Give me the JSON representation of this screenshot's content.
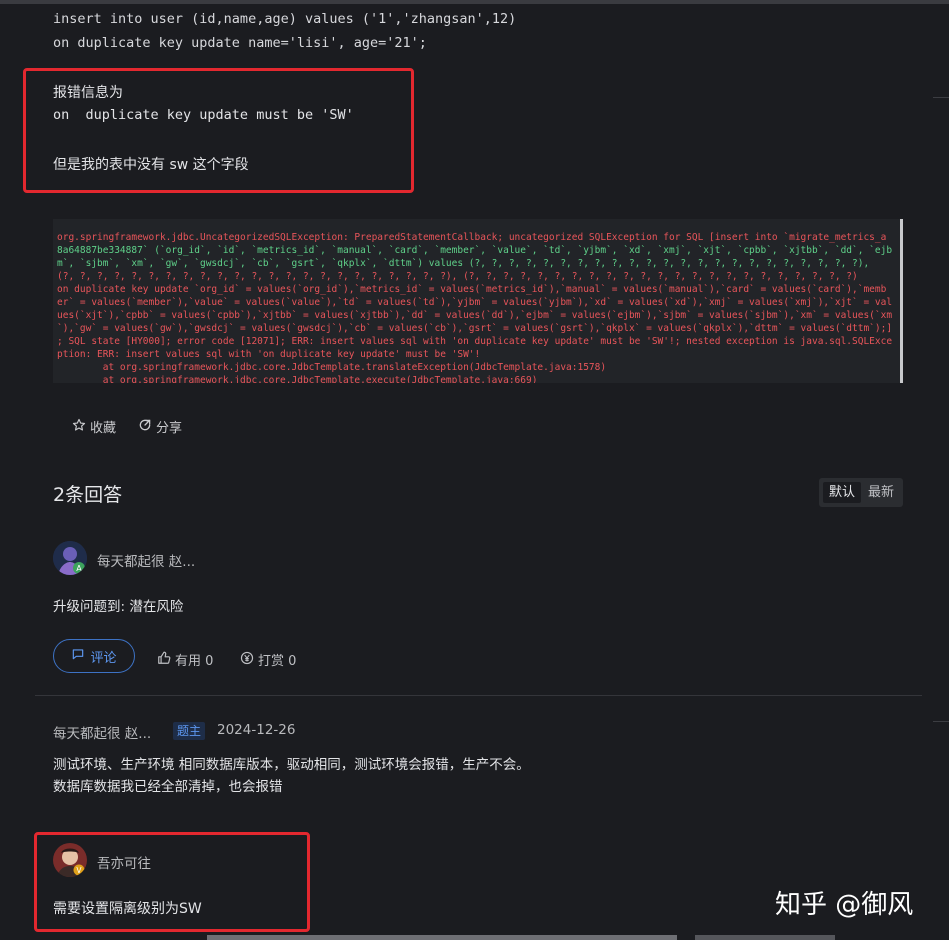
{
  "question": {
    "sql_lines": [
      "insert into user (id,name,age) values ('1','zhangsan',12)",
      "on duplicate key update name='lisi', age='21';"
    ],
    "error_note_lines": [
      "报错信息为",
      "on  duplicate key update must be 'SW'",
      "但是我的表中没有 sw 这个字段"
    ],
    "log_lines": [
      {
        "text": "org.springframework.jdbc.UncategorizedSQLException: PreparedStatementCallback; uncategorized SQLException for SQL [insert into `migrate_metrics_a",
        "c": "r"
      },
      {
        "text": "8a64887be334887` (`org_id`, `id`, `metrics_id`, `manual`, `card`, `member`, `value`, `td`, `yjbm`, `xd`, `xmj`, `xjt`, `cpbb`, `xjtbb`, `dd`, `ejb",
        "c": "g"
      },
      {
        "text": "m`, `sjbm`, `xm`, `gw`, `gwsdcj`, `cb`, `gsrt`, `qkplx`, `dttm`) values (?, ?, ?, ?, ?, ?, ?, ?, ?, ?, ?, ?, ?, ?, ?, ?, ?, ?, ?, ?, ?, ?, ?),",
        "c": "g"
      },
      {
        "text": "(?, ?, ?, ?, ?, ?, ?, ?, ?, ?, ?, ?, ?, ?, ?, ?, ?, ?, ?, ?, ?, ?, ?), (?, ?, ?, ?, ?, ?, ?, ?, ?, ?, ?, ?, ?, ?, ?, ?, ?, ?, ?, ?, ?, ?, ?)",
        "c": "r"
      },
      {
        "text": "on duplicate key update `org_id` = values(`org_id`),`metrics_id` = values(`metrics_id`),`manual` = values(`manual`),`card` = values(`card`),`memb",
        "c": "r"
      },
      {
        "text": "er` = values(`member`),`value` = values(`value`),`td` = values(`td`),`yjbm` = values(`yjbm`),`xd` = values(`xd`),`xmj` = values(`xmj`),`xjt` = val",
        "c": "r"
      },
      {
        "text": "ues(`xjt`),`cpbb` = values(`cpbb`),`xjtbb` = values(`xjtbb`),`dd` = values(`dd`),`ejbm` = values(`ejbm`),`sjbm` = values(`sjbm`),`xm` = values(`xm",
        "c": "r"
      },
      {
        "text": "`),`gw` = values(`gw`),`gwsdcj` = values(`gwsdcj`),`cb` = values(`cb`),`gsrt` = values(`gsrt`),`qkplx` = values(`qkplx`),`dttm` = values(`dttm`);]",
        "c": "r"
      },
      {
        "text": "; SQL state [HY000]; error code [12071]; ERR: insert values sql with 'on duplicate key update' must be 'SW'!; nested exception is java.sql.SQLExce",
        "c": "r"
      },
      {
        "text": "ption: ERR: insert values sql with 'on duplicate key update' must be 'SW'!",
        "c": "r"
      },
      {
        "text": "        at org.springframework.jdbc.core.JdbcTemplate.translateException(JdbcTemplate.java:1578)",
        "c": "r"
      },
      {
        "text": "        at org.springframework.jdbc.core.JdbcTemplate.execute(JdbcTemplate.java:669)",
        "c": "r"
      }
    ],
    "actions": {
      "favorite": "收藏",
      "share": "分享"
    }
  },
  "answers": {
    "title": "2条回答",
    "sort_default": "默认",
    "sort_latest": "最新",
    "list": [
      {
        "author": "每天都起很 赵...",
        "content": "升级问题到: 潜在风险",
        "comment_label": "评论",
        "useful_label": "有用 0",
        "reward_label": "打赏 0",
        "reply": {
          "author": "每天都起很 赵...",
          "tag": "题主",
          "date": "2024-12-26",
          "lines": [
            "测试环境、生产环境 相同数据库版本，驱动相同，测试环境会报错，生产不会。",
            "数据库数据我已经全部清掉，也会报错"
          ]
        }
      },
      {
        "author": "吾亦可往",
        "content": "需要设置隔离级别为SW"
      }
    ]
  },
  "watermark": "知乎 @御风",
  "colors": {
    "highlight_box": "#e3282f",
    "accent": "#3d72c4",
    "background": "#1b1c20"
  }
}
